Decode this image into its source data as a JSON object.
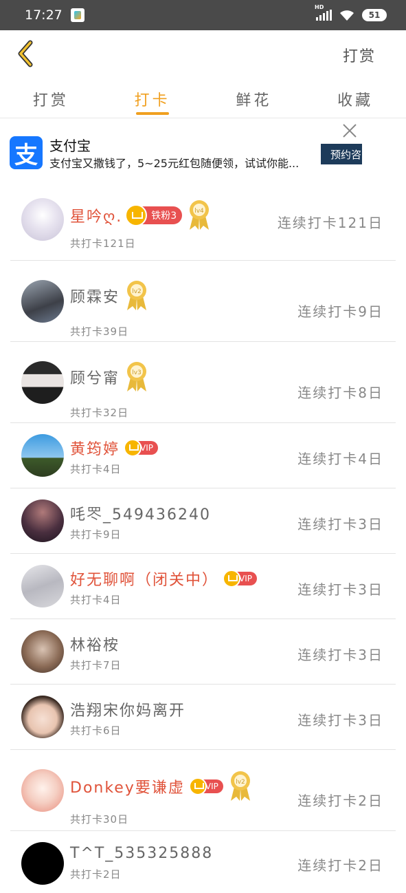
{
  "status": {
    "time": "17:27",
    "battery": "51",
    "network_label": "HD"
  },
  "header": {
    "action_label": "打赏"
  },
  "tabs": [
    {
      "label": "打赏"
    },
    {
      "label": "打卡"
    },
    {
      "label": "鲜花"
    },
    {
      "label": "收藏"
    }
  ],
  "active_tab": 1,
  "ad": {
    "logo_char": "支",
    "title": "支付宝",
    "description": "支付宝又撒钱了，5~25元红包随便领，试试你能...",
    "button": "预约咨"
  },
  "colors": {
    "accent": "#f0a020",
    "vip_red": "#e85050",
    "alipay_blue": "#1677ff"
  },
  "users": [
    {
      "name": "星吟ღ.",
      "red": true,
      "badge": "铁粉3",
      "medal": "lv4",
      "total": "共打卡121日",
      "streak": "连续打卡121日"
    },
    {
      "name": "顾霖安",
      "red": false,
      "medal": "lv2",
      "total": "共打卡39日",
      "streak": "连续打卡9日"
    },
    {
      "name": "顾兮甯",
      "red": false,
      "medal": "lv3",
      "total": "共打卡32日",
      "streak": "连续打卡8日"
    },
    {
      "name": "黄筠婷",
      "red": true,
      "vip": "VIP",
      "total": "共打卡4日",
      "streak": "连续打卡4日"
    },
    {
      "name": "㕰罖_549436240",
      "red": false,
      "total": "共打卡9日",
      "streak": "连续打卡3日"
    },
    {
      "name": "好无聊啊（闭关中）",
      "red": true,
      "vip": "VIP",
      "total": "共打卡4日",
      "streak": "连续打卡3日"
    },
    {
      "name": "林裕桉",
      "red": false,
      "total": "共打卡7日",
      "streak": "连续打卡3日"
    },
    {
      "name": "浩翔宋你妈离开",
      "red": false,
      "total": "共打卡6日",
      "streak": "连续打卡3日"
    },
    {
      "name": "Donkey要谦虚",
      "red": true,
      "vip": "VIP",
      "medal": "lv2",
      "total": "共打卡30日",
      "streak": "连续打卡2日"
    },
    {
      "name": "T^T_535325888",
      "red": false,
      "total": "共打卡2日",
      "streak": "连续打卡2日"
    }
  ]
}
